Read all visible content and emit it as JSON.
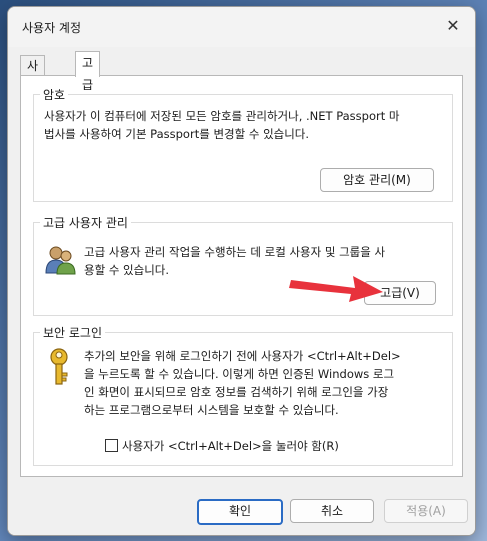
{
  "window": {
    "title": "사용자 계정"
  },
  "tabs": [
    {
      "label": "사용자"
    },
    {
      "label": "고급"
    }
  ],
  "passwords": {
    "heading": "암호",
    "line1": "사용자가 이 컴퓨터에 저장된 모든 암호를 관리하거나, .NET Passport 마",
    "line2": "법사를 사용하여 기본 Passport를 변경할 수 있습니다.",
    "button": "암호 관리(M)"
  },
  "advanced_user_mgmt": {
    "heading": "고급 사용자 관리",
    "line1": "고급 사용자 관리 작업을 수행하는 데 로컬 사용자 및 그룹을 사",
    "line2": "용할 수 있습니다.",
    "button": "고급(V)"
  },
  "secure_logon": {
    "heading": "보안 로그인",
    "line1": "추가의 보안을 위해 로그인하기 전에 사용자가 <Ctrl+Alt+Del>",
    "line2": "을 누르도록 할 수 있습니다. 이렇게 하면 인증된 Windows 로그",
    "line3": "인 화면이 표시되므로 암호 정보를 검색하기 위해 로그인을 가장",
    "line4": "하는 프로그램으로부터 시스템을 보호할 수 있습니다.",
    "checkbox_label": "사용자가 <Ctrl+Alt+Del>을 눌러야 함(R)",
    "checkbox_checked": false
  },
  "footer": {
    "ok": "확인",
    "cancel": "취소",
    "apply": "적용(A)"
  },
  "colors": {
    "arrow": "#e8323c",
    "accent": "#2a6bc4"
  }
}
